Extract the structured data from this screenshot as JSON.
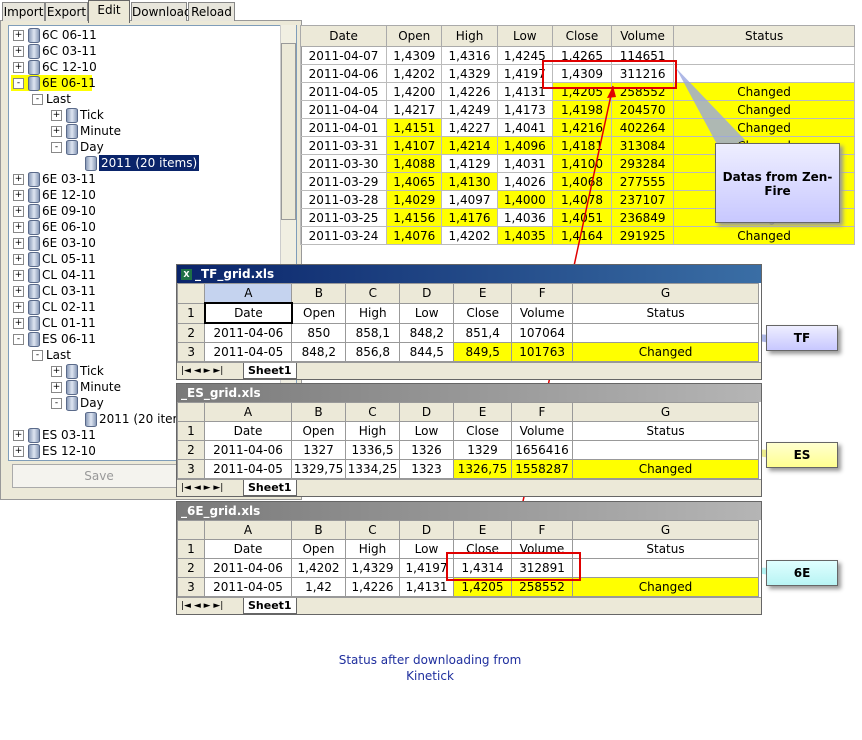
{
  "tabs": [
    "Import",
    "Export",
    "Edit",
    "Download",
    "Reload"
  ],
  "tree": [
    {
      "label": "6C 06-11",
      "level": 0,
      "exp": "+"
    },
    {
      "label": "6C 03-11",
      "level": 0,
      "exp": "+"
    },
    {
      "label": "6C 12-10",
      "level": 0,
      "exp": "+"
    },
    {
      "label": "6E 06-11",
      "level": 0,
      "exp": "-",
      "highlight": "yellow"
    },
    {
      "label": "Last",
      "level": 1,
      "exp": "-",
      "noicon": true
    },
    {
      "label": "Tick",
      "level": 2,
      "exp": "+"
    },
    {
      "label": "Minute",
      "level": 2,
      "exp": "+"
    },
    {
      "label": "Day",
      "level": 2,
      "exp": "-"
    },
    {
      "label": "2011 (20 items)",
      "level": 3,
      "highlight": "blue"
    },
    {
      "label": "6E 03-11",
      "level": 0,
      "exp": "+"
    },
    {
      "label": "6E 12-10",
      "level": 0,
      "exp": "+"
    },
    {
      "label": "6E 09-10",
      "level": 0,
      "exp": "+"
    },
    {
      "label": "6E 06-10",
      "level": 0,
      "exp": "+"
    },
    {
      "label": "6E 03-10",
      "level": 0,
      "exp": "+"
    },
    {
      "label": "CL 05-11",
      "level": 0,
      "exp": "+"
    },
    {
      "label": "CL 04-11",
      "level": 0,
      "exp": "+"
    },
    {
      "label": "CL 03-11",
      "level": 0,
      "exp": "+"
    },
    {
      "label": "CL 02-11",
      "level": 0,
      "exp": "+"
    },
    {
      "label": "CL 01-11",
      "level": 0,
      "exp": "+"
    },
    {
      "label": "ES 06-11",
      "level": 0,
      "exp": "-"
    },
    {
      "label": "Last",
      "level": 1,
      "exp": "-",
      "noicon": true
    },
    {
      "label": "Tick",
      "level": 2,
      "exp": "+"
    },
    {
      "label": "Minute",
      "level": 2,
      "exp": "+"
    },
    {
      "label": "Day",
      "level": 2,
      "exp": "-"
    },
    {
      "label": "2011 (20 items",
      "level": 3
    },
    {
      "label": "ES 03-11",
      "level": 0,
      "exp": "+"
    },
    {
      "label": "ES 12-10",
      "level": 0,
      "exp": "+"
    }
  ],
  "save_label": "Save",
  "grid": {
    "headers": [
      "Date",
      "Open",
      "High",
      "Low",
      "Close",
      "Volume",
      "Status"
    ],
    "rows": [
      {
        "cells": [
          "2011-04-07",
          "1,4309",
          "1,4316",
          "1,4245",
          "1,4265",
          "114651",
          ""
        ],
        "y": []
      },
      {
        "cells": [
          "2011-04-06",
          "1,4202",
          "1,4329",
          "1,4197",
          "1,4309",
          "311216",
          ""
        ],
        "y": []
      },
      {
        "cells": [
          "2011-04-05",
          "1,4200",
          "1,4226",
          "1,4131",
          "1,4205",
          "258552",
          "Changed"
        ],
        "y": [
          4,
          5,
          6
        ]
      },
      {
        "cells": [
          "2011-04-04",
          "1,4217",
          "1,4249",
          "1,4173",
          "1,4198",
          "204570",
          "Changed"
        ],
        "y": [
          4,
          5,
          6
        ]
      },
      {
        "cells": [
          "2011-04-01",
          "1,4151",
          "1,4227",
          "1,4041",
          "1,4216",
          "402264",
          "Changed"
        ],
        "y": [
          1,
          4,
          5,
          6
        ]
      },
      {
        "cells": [
          "2011-03-31",
          "1,4107",
          "1,4214",
          "1,4096",
          "1,4181",
          "313084",
          "Changed"
        ],
        "y": [
          1,
          2,
          3,
          4,
          5,
          6
        ]
      },
      {
        "cells": [
          "2011-03-30",
          "1,4088",
          "1,4129",
          "1,4031",
          "1,4100",
          "293284",
          "Changed"
        ],
        "y": [
          1,
          4,
          5,
          6
        ]
      },
      {
        "cells": [
          "2011-03-29",
          "1,4065",
          "1,4130",
          "1,4026",
          "1,4068",
          "277555",
          "Changed"
        ],
        "y": [
          1,
          2,
          4,
          5,
          6
        ]
      },
      {
        "cells": [
          "2011-03-28",
          "1,4029",
          "1,4097",
          "1,4000",
          "1,4078",
          "237107",
          "Changed"
        ],
        "y": [
          1,
          3,
          4,
          5,
          6
        ]
      },
      {
        "cells": [
          "2011-03-25",
          "1,4156",
          "1,4176",
          "1,4036",
          "1,4051",
          "236849",
          "Changed"
        ],
        "y": [
          1,
          2,
          4,
          5,
          6
        ]
      },
      {
        "cells": [
          "2011-03-24",
          "1,4076",
          "1,4202",
          "1,4035",
          "1,4164",
          "291925",
          "Changed"
        ],
        "y": [
          1,
          3,
          4,
          5,
          6
        ]
      }
    ]
  },
  "excel": [
    {
      "title": "_TF_grid.xls",
      "active": true,
      "col_letters": [
        "A",
        "B",
        "C",
        "D",
        "E",
        "F",
        "G"
      ],
      "rows": [
        {
          "n": "1",
          "cells": [
            "Date",
            "Open",
            "High",
            "Low",
            "Close",
            "Volume",
            "Status"
          ],
          "y": []
        },
        {
          "n": "2",
          "cells": [
            "2011-04-06",
            "850",
            "858,1",
            "848,2",
            "851,4",
            "107064",
            ""
          ],
          "y": []
        },
        {
          "n": "3",
          "cells": [
            "2011-04-05",
            "848,2",
            "856,8",
            "844,5",
            "849,5",
            "101763",
            "Changed"
          ],
          "y": [
            4,
            5,
            6
          ]
        }
      ],
      "sheet": "Sheet1"
    },
    {
      "title": "_ES_grid.xls",
      "active": false,
      "col_letters": [
        "A",
        "B",
        "C",
        "D",
        "E",
        "F",
        "G"
      ],
      "rows": [
        {
          "n": "1",
          "cells": [
            "Date",
            "Open",
            "High",
            "Low",
            "Close",
            "Volume",
            "Status"
          ],
          "y": []
        },
        {
          "n": "2",
          "cells": [
            "2011-04-06",
            "1327",
            "1336,5",
            "1326",
            "1329",
            "1656416",
            ""
          ],
          "y": []
        },
        {
          "n": "3",
          "cells": [
            "2011-04-05",
            "1329,75",
            "1334,25",
            "1323",
            "1326,75",
            "1558287",
            "Changed"
          ],
          "y": [
            4,
            5,
            6
          ]
        }
      ],
      "sheet": "Sheet1"
    },
    {
      "title": "_6E_grid.xls",
      "active": false,
      "col_letters": [
        "A",
        "B",
        "C",
        "D",
        "E",
        "F",
        "G"
      ],
      "rows": [
        {
          "n": "1",
          "cells": [
            "Date",
            "Open",
            "High",
            "Low",
            "Close",
            "Volume",
            "Status"
          ],
          "y": []
        },
        {
          "n": "2",
          "cells": [
            "2011-04-06",
            "1,4202",
            "1,4329",
            "1,4197",
            "1,4314",
            "312891",
            ""
          ],
          "y": []
        },
        {
          "n": "3",
          "cells": [
            "2011-04-05",
            "1,42",
            "1,4226",
            "1,4131",
            "1,4205",
            "258552",
            "Changed"
          ],
          "y": [
            4,
            5,
            6
          ]
        }
      ],
      "sheet": "Sheet1"
    }
  ],
  "callouts": {
    "zenfire": "Datas from Zen-Fire",
    "tf": "TF",
    "es": "ES",
    "sixe": "6E"
  },
  "caption_line1": "Status after downloading from",
  "caption_line2": "Kinetick",
  "colors": {
    "changed": "#ffff00",
    "selection": "#0a246a",
    "callout_blue": "#c8c8ff",
    "callout_yellow": "#ffffa0",
    "callout_cyan": "#c8ffff",
    "arrow": "#e00000"
  }
}
